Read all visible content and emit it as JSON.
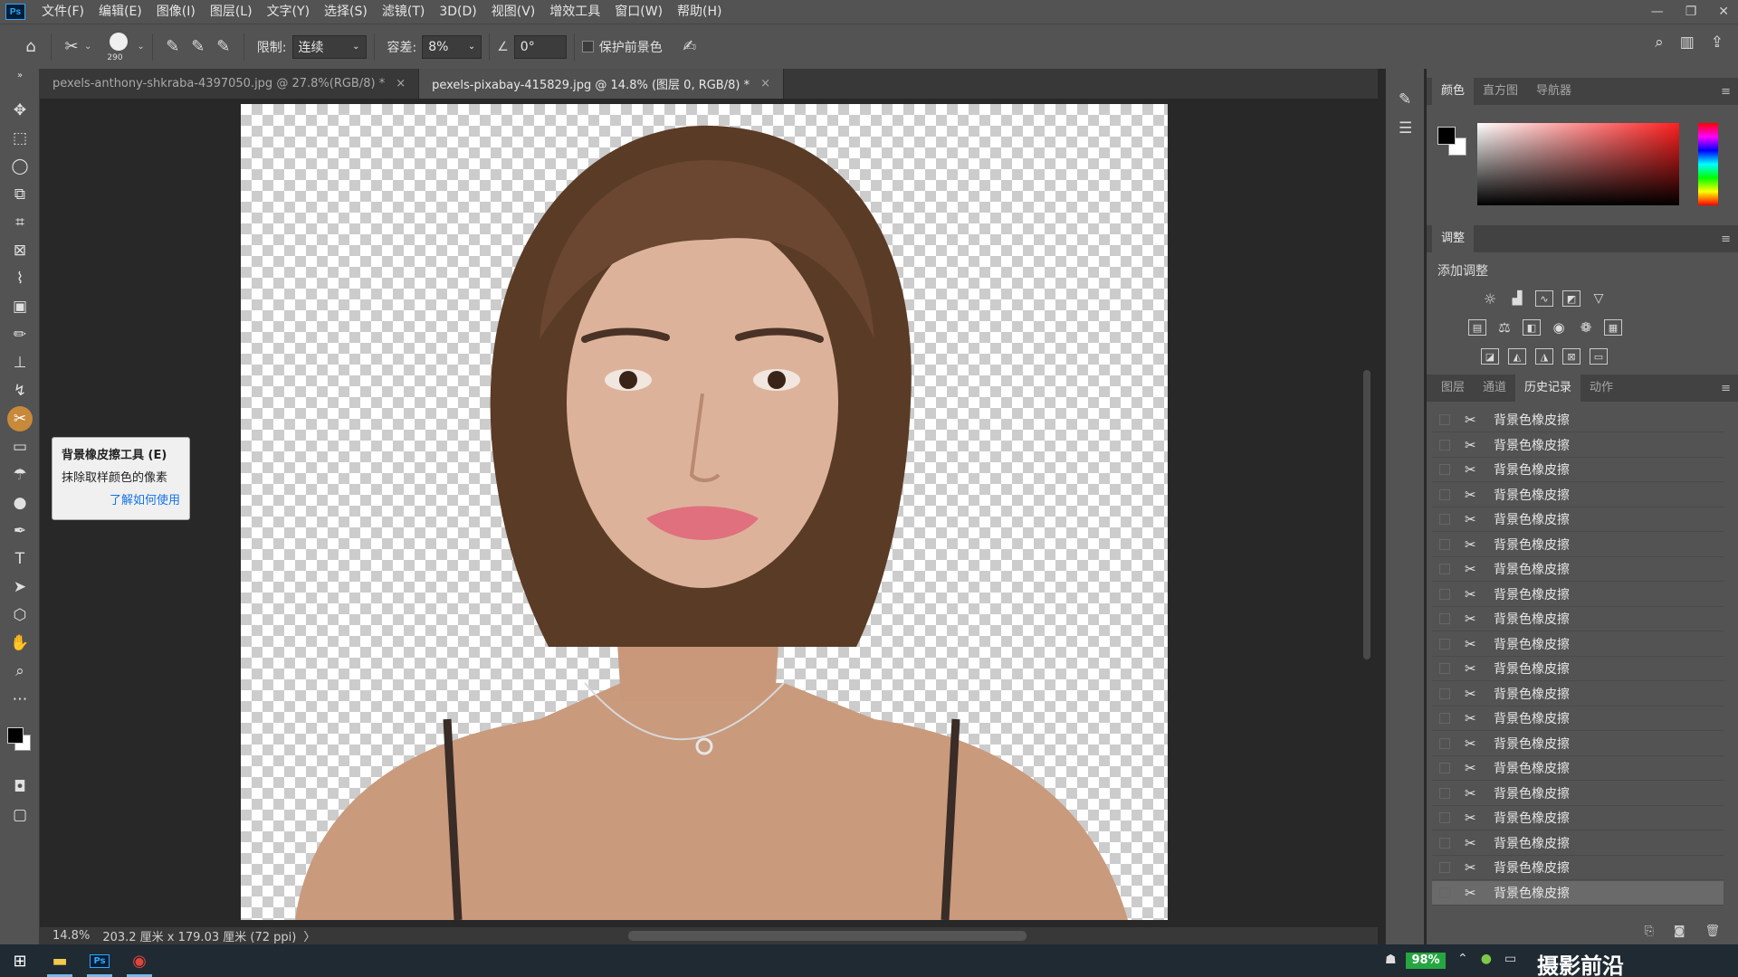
{
  "app": {
    "logo": "Ps"
  },
  "menu": [
    "文件(F)",
    "编辑(E)",
    "图像(I)",
    "图层(L)",
    "文字(Y)",
    "选择(S)",
    "滤镜(T)",
    "3D(D)",
    "视图(V)",
    "增效工具",
    "窗口(W)",
    "帮助(H)"
  ],
  "options": {
    "brush_size": "290",
    "limit_label": "限制:",
    "limit_value": "连续",
    "tolerance_label": "容差:",
    "tolerance_value": "8%",
    "angle_value": "0°",
    "protect_fg_label": "保护前景色"
  },
  "tabs": [
    {
      "label": "pexels-anthony-shkraba-4397050.jpg @ 27.8%(RGB/8) *",
      "close": "×"
    },
    {
      "label": "pexels-pixabay-415829.jpg @ 14.8% (图层 0, RGB/8) *",
      "close": "×"
    }
  ],
  "status": {
    "zoom": "14.8%",
    "doc_info": "203.2 厘米 x 179.03 厘米 (72 ppi)",
    "arrow": "〉"
  },
  "tooltip": {
    "title": "背景橡皮擦工具 (E)",
    "desc": "抹除取样颜色的像素",
    "link": "了解如何使用"
  },
  "panels": {
    "color_tabs": [
      "颜色",
      "直方图",
      "导航器"
    ],
    "adjust_tab": "调整",
    "adjust_add": "添加调整",
    "history_tabs": [
      "图层",
      "通道",
      "历史记录",
      "动作"
    ]
  },
  "history": [
    "背景色橡皮擦",
    "背景色橡皮擦",
    "背景色橡皮擦",
    "背景色橡皮擦",
    "背景色橡皮擦",
    "背景色橡皮擦",
    "背景色橡皮擦",
    "背景色橡皮擦",
    "背景色橡皮擦",
    "背景色橡皮擦",
    "背景色橡皮擦",
    "背景色橡皮擦",
    "背景色橡皮擦",
    "背景色橡皮擦",
    "背景色橡皮擦",
    "背景色橡皮擦",
    "背景色橡皮擦",
    "背景色橡皮擦",
    "背景色橡皮擦",
    "背景色橡皮擦"
  ],
  "taskbar": {
    "battery": "98%",
    "watermark": "摄影前沿sheyingyz.com"
  },
  "colors": {
    "accent": "#31a8ff",
    "panel": "#535353",
    "canvas": "#282828"
  }
}
